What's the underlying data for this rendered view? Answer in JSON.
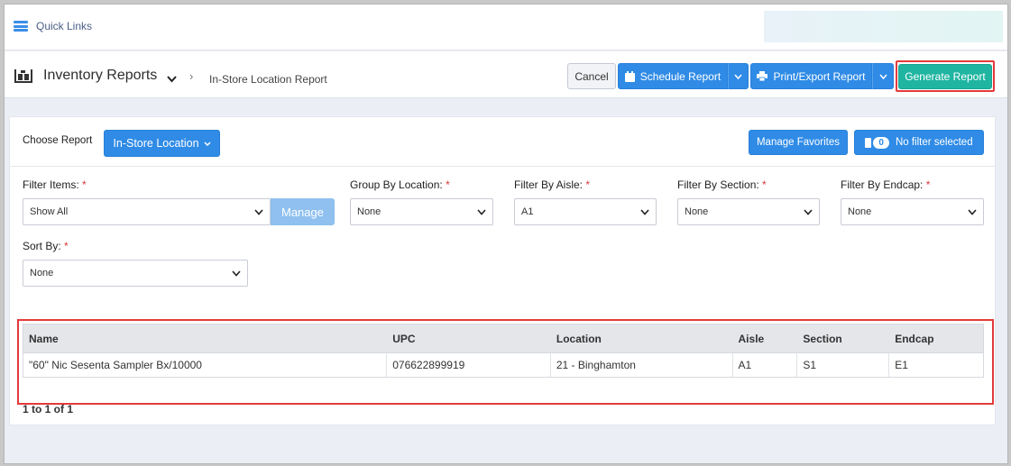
{
  "topbar": {
    "quick_links": "Quick Links"
  },
  "header": {
    "title": "Inventory Reports",
    "breadcrumb_current": "In-Store Location Report",
    "cancel": "Cancel",
    "schedule": "Schedule Report",
    "print": "Print/Export Report",
    "generate": "Generate Report"
  },
  "panel": {
    "choose_label": "Choose Report",
    "report_button": "In-Store Location",
    "manage_favorites": "Manage Favorites",
    "filter_count": "0",
    "filter_text": "No filter selected"
  },
  "filters": {
    "filter_items": {
      "label": "Filter Items:",
      "value": "Show All",
      "manage": "Manage"
    },
    "group_by_location": {
      "label": "Group By Location:",
      "value": "None"
    },
    "filter_by_aisle": {
      "label": "Filter By Aisle:",
      "value": "A1"
    },
    "filter_by_section": {
      "label": "Filter By Section:",
      "value": "None"
    },
    "filter_by_endcap": {
      "label": "Filter By Endcap:",
      "value": "None"
    },
    "sort_by": {
      "label": "Sort By:",
      "value": "None"
    },
    "required_marker": "*"
  },
  "grid": {
    "columns": [
      "Name",
      "UPC",
      "Location",
      "Aisle",
      "Section",
      "Endcap"
    ],
    "rows": [
      [
        "\"60\" Nic Sesenta Sampler Bx/10000",
        "076622899919",
        "21 - Binghamton",
        "A1",
        "S1",
        "E1"
      ]
    ],
    "pager": "1 to 1 of 1"
  },
  "colors": {
    "primary": "#2f8be6",
    "generate": "#1fb5a1",
    "highlight": "#e33b3b"
  }
}
